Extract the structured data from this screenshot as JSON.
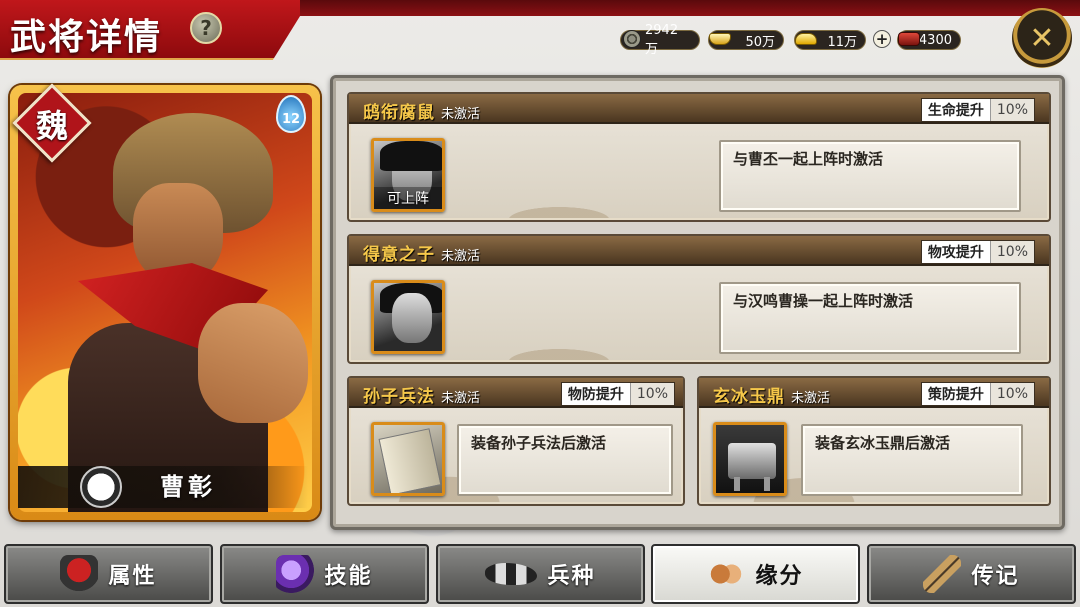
{
  "header": {
    "title": "武将详情",
    "help_icon": "question-mark-icon",
    "close_icon": "crossed-swords-close-icon"
  },
  "resources": [
    {
      "icon": "copper-coin-icon",
      "value": "2942万"
    },
    {
      "icon": "silver-ingot-icon",
      "value": "50万"
    },
    {
      "icon": "gold-ingot-icon",
      "value": "11万"
    },
    {
      "icon": "red-gem-icon",
      "value": "4300"
    }
  ],
  "hero": {
    "faction": "魏",
    "cost": "12",
    "name": "曹彰",
    "class_icon": "cavalry-class-icon"
  },
  "bonds": [
    {
      "name": "鸱衔腐鼠",
      "status": "未激活",
      "bonus_type": "生命提升",
      "bonus_value": "10%",
      "portrait_icon": "hero-portrait-icon",
      "portrait_label": "可上阵",
      "description": "与曹丕一起上阵时激活"
    },
    {
      "name": "得意之子",
      "status": "未激活",
      "bonus_type": "物攻提升",
      "bonus_value": "10%",
      "portrait_icon": "hero-portrait-icon",
      "portrait_label": "",
      "description": "与汉鸣曹操一起上阵时激活"
    },
    {
      "name": "孙子兵法",
      "status": "未激活",
      "bonus_type": "物防提升",
      "bonus_value": "10%",
      "portrait_icon": "book-item-icon",
      "portrait_label": "",
      "description": "装备孙子兵法后激活"
    },
    {
      "name": "玄冰玉鼎",
      "status": "未激活",
      "bonus_type": "策防提升",
      "bonus_value": "10%",
      "portrait_icon": "cauldron-item-icon",
      "portrait_label": "",
      "description": "装备玄冰玉鼎后激活"
    }
  ],
  "tabs": [
    {
      "label": "属性",
      "icon": "helmet-icon",
      "active": false
    },
    {
      "label": "技能",
      "icon": "skill-orb-icon",
      "active": false
    },
    {
      "label": "兵种",
      "icon": "tiger-icon",
      "active": false
    },
    {
      "label": "缘分",
      "icon": "handshake-icon",
      "active": true
    },
    {
      "label": "传记",
      "icon": "scroll-icon",
      "active": false
    }
  ],
  "colors": {
    "title_banner": "#b0141a",
    "bond_name": "#f6c84a",
    "portrait_border": "#d98c1a"
  }
}
